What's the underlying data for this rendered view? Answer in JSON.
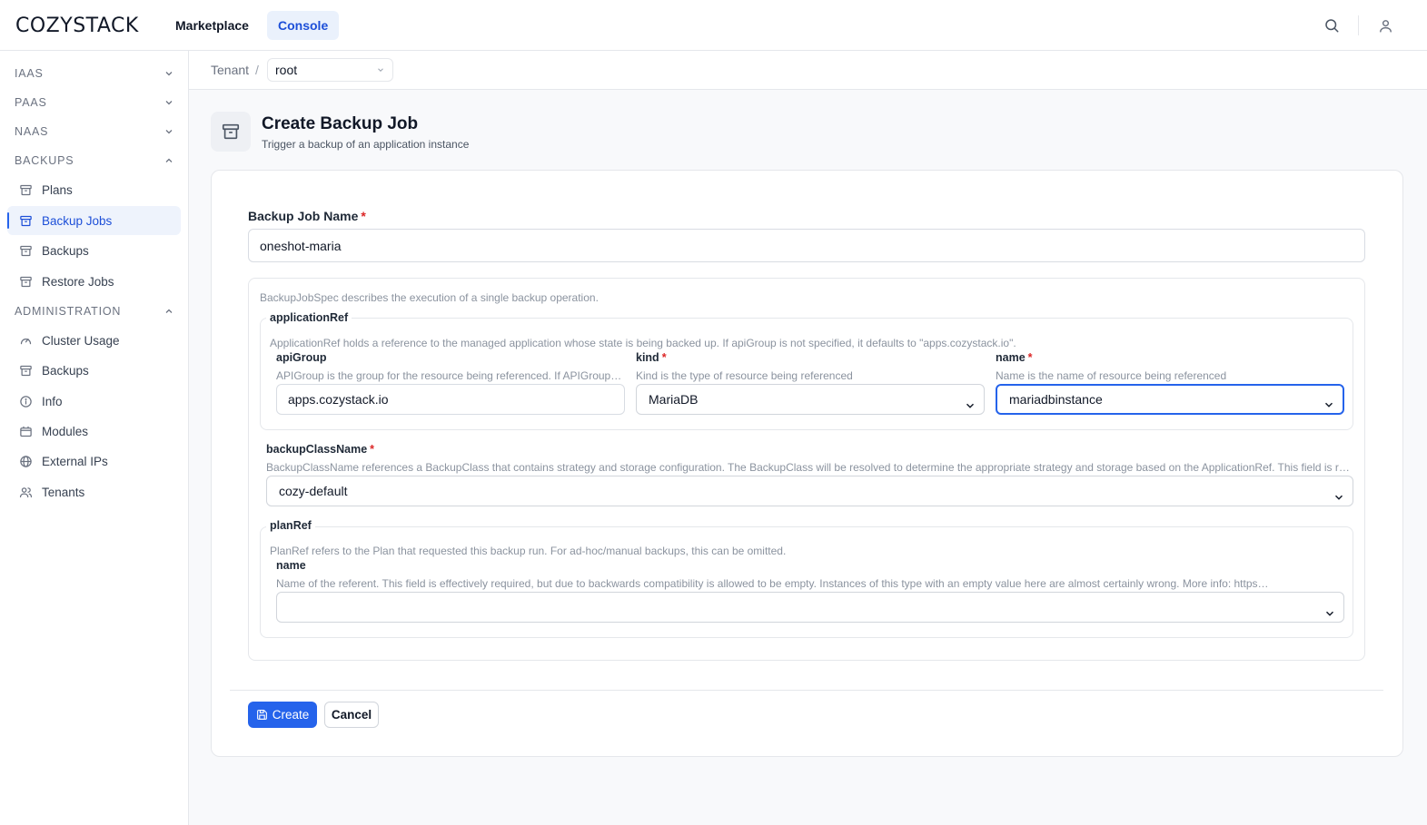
{
  "header": {
    "logo": "COZYSTACK",
    "nav": [
      {
        "label": "Marketplace"
      },
      {
        "label": "Console",
        "active": true
      }
    ],
    "icons": [
      "search-icon",
      "user-icon"
    ]
  },
  "sidebar": {
    "sections": {
      "iaas": "IAAS",
      "paas": "PAAS",
      "naas": "NAAS",
      "backups": "BACKUPS",
      "administration": "ADMINISTRATION"
    },
    "backups_items": [
      {
        "label": "Plans",
        "icon": "archive-icon"
      },
      {
        "label": "Backup Jobs",
        "icon": "archive-icon",
        "active": true
      },
      {
        "label": "Backups",
        "icon": "archive-icon"
      },
      {
        "label": "Restore Jobs",
        "icon": "archive-icon"
      }
    ],
    "admin_items": [
      {
        "label": "Cluster Usage",
        "icon": "gauge-icon"
      },
      {
        "label": "Backups",
        "icon": "archive-icon"
      },
      {
        "label": "Info",
        "icon": "info-icon"
      },
      {
        "label": "Modules",
        "icon": "box-icon"
      },
      {
        "label": "External IPs",
        "icon": "globe-icon"
      },
      {
        "label": "Tenants",
        "icon": "users-icon"
      }
    ]
  },
  "breadcrumb": {
    "tenant_label": "Tenant",
    "separator": "/",
    "tenant_value": "root"
  },
  "page": {
    "title": "Create Backup Job",
    "subtitle": "Trigger a backup of an application instance"
  },
  "form": {
    "job_name": {
      "label": "Backup Job Name",
      "value": "oneshot-maria"
    },
    "spec_description": "BackupJobSpec describes the execution of a single backup operation.",
    "application_ref": {
      "legend": "applicationRef",
      "description": "ApplicationRef holds a reference to the managed application whose state is being backed up. If apiGroup is not specified, it defaults to \"apps.cozystack.io\".",
      "api_group": {
        "label": "apiGroup",
        "description": "APIGroup is the group for the resource being referenced. If APIGroup is not specified, the specified Kind must be in the core API group.",
        "value": "apps.cozystack.io"
      },
      "kind": {
        "label": "kind",
        "description": "Kind is the type of resource being referenced",
        "value": "MariaDB"
      },
      "name": {
        "label": "name",
        "description": "Name is the name of resource being referenced",
        "value": "mariadbinstance"
      }
    },
    "backup_class_name": {
      "label": "backupClassName",
      "description": "BackupClassName references a BackupClass that contains strategy and storage configuration. The BackupClass will be resolved to determine the appropriate strategy and storage based on the ApplicationRef. This field is required.",
      "value": "cozy-default"
    },
    "plan_ref": {
      "legend": "planRef",
      "description": "PlanRef refers to the Plan that requested this backup run. For ad-hoc/manual backups, this can be omitted.",
      "name": {
        "label": "name",
        "description": "Name of the referent. This field is effectively required, but due to backwards compatibility is allowed to be empty. Instances of this type with an empty value here are almost certainly wrong. More info: https://kubernetes.io/docs/concepts/overview/working-with-objects/names/#names",
        "value": ""
      }
    },
    "actions": {
      "create": "Create",
      "cancel": "Cancel"
    }
  },
  "colors": {
    "accent": "#2563eb",
    "required": "#dc2626"
  }
}
